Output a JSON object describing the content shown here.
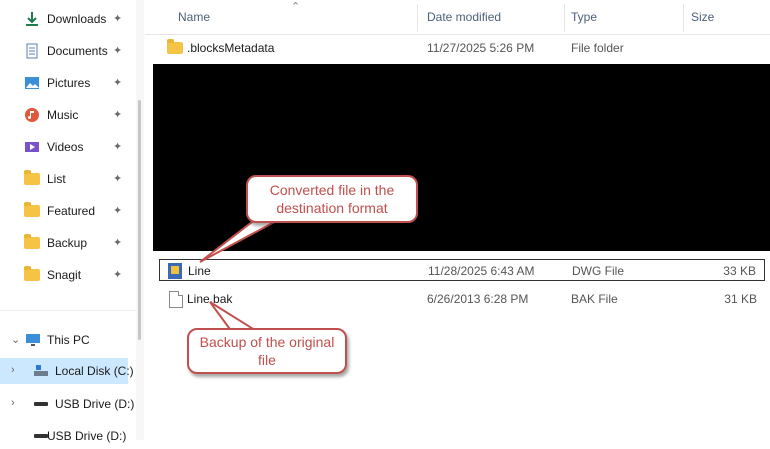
{
  "sidebar": {
    "quick_access": [
      {
        "label": "Downloads",
        "icon": "download-icon"
      },
      {
        "label": "Documents",
        "icon": "documents-icon"
      },
      {
        "label": "Pictures",
        "icon": "pictures-icon"
      },
      {
        "label": "Music",
        "icon": "music-icon"
      },
      {
        "label": "Videos",
        "icon": "videos-icon"
      },
      {
        "label": "List",
        "icon": "folder-icon"
      },
      {
        "label": "Featured",
        "icon": "folder-icon"
      },
      {
        "label": "Backup",
        "icon": "folder-icon"
      },
      {
        "label": "Snagit",
        "icon": "folder-icon"
      }
    ],
    "pin_glyph": "📌",
    "this_pc": "This PC",
    "drives": [
      {
        "label": "Local Disk (C:)"
      },
      {
        "label": "USB Drive (D:)"
      },
      {
        "label": "USB Drive (D:)"
      }
    ]
  },
  "columns": {
    "name": "Name",
    "date": "Date modified",
    "type": "Type",
    "size": "Size"
  },
  "files": [
    {
      "name": ".blocksMetadata",
      "date": "11/27/2025 5:26 PM",
      "type": "File folder",
      "size": ""
    },
    {
      "name": "Line",
      "date": "11/28/2025 6:43 AM",
      "type": "DWG File",
      "size": "33 KB"
    },
    {
      "name": "Line.bak",
      "date": "6/26/2013 6:28 PM",
      "type": "BAK File",
      "size": "31 KB"
    }
  ],
  "callouts": {
    "converted": "Converted file in the destination format",
    "backup": "Backup of the original file"
  },
  "colors": {
    "accent": "#c0504d",
    "selected": "#cce8ff"
  }
}
